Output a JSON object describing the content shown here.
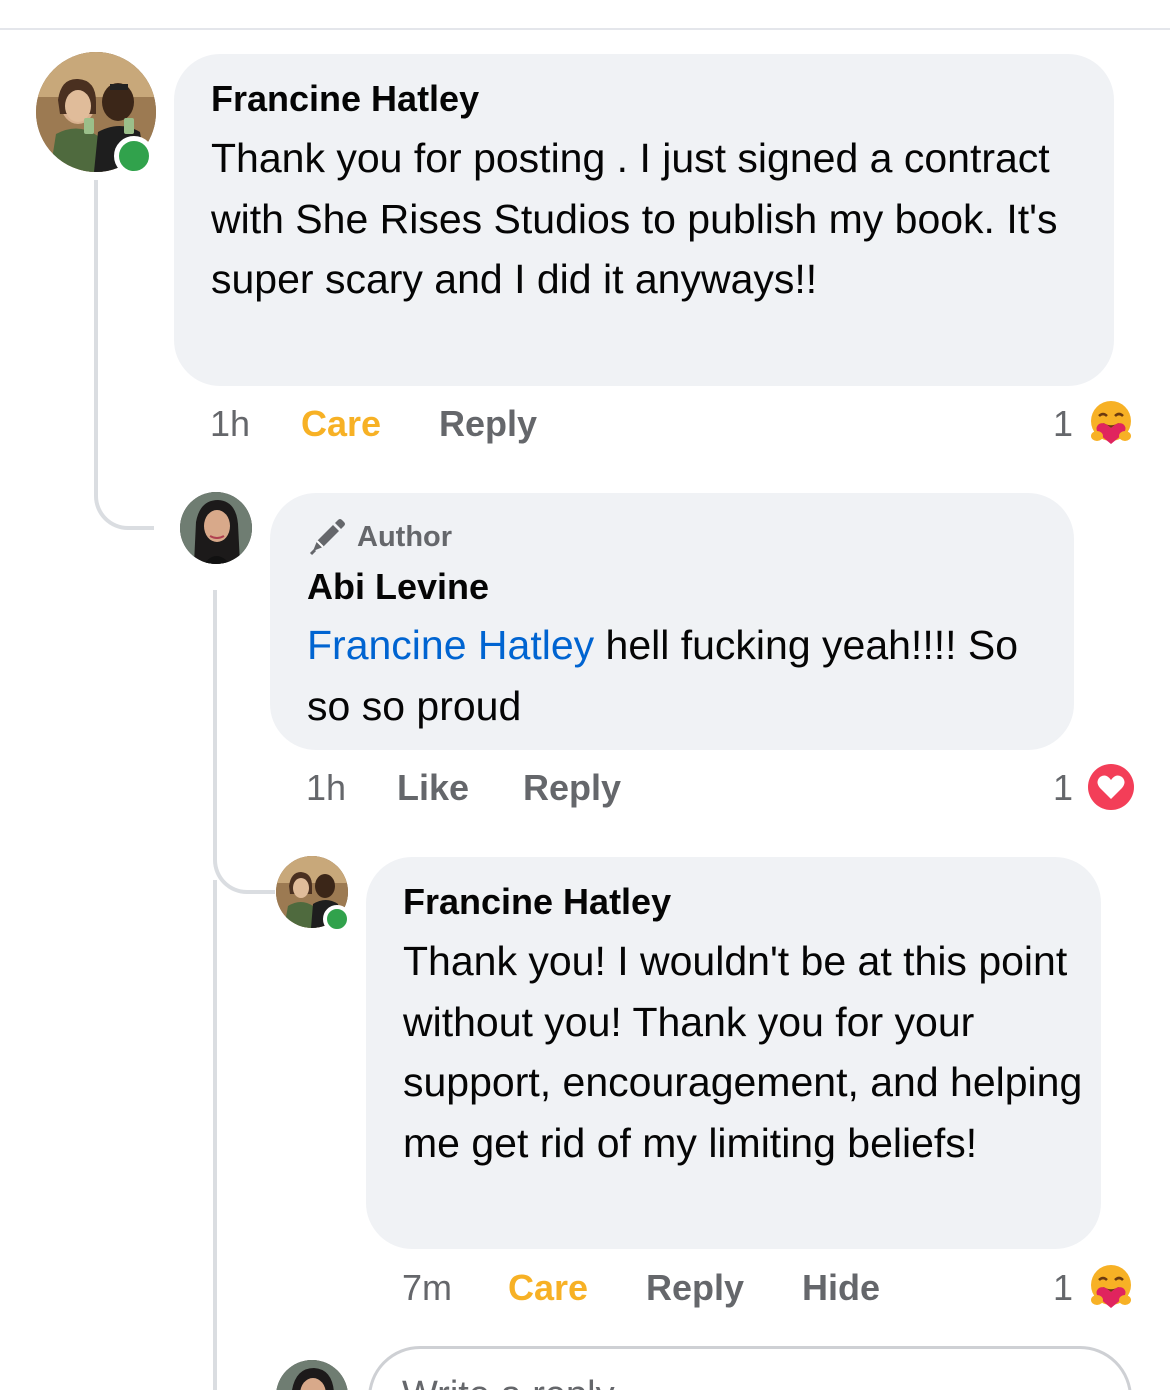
{
  "comments": [
    {
      "author": "Francine Hatley",
      "text": "Thank you for posting . I just signed a contract with She Rises Studios to publish my book. It's super scary and I did it anyways!!",
      "time": "1h",
      "reaction_action": "Care",
      "reply_label": "Reply",
      "reaction_count": "1",
      "reaction_icon": "care-emoji-icon"
    },
    {
      "badge": "Author",
      "badge_icon": "pen-icon",
      "author": "Abi Levine",
      "mention": "Francine Hatley",
      "text_after_mention": " hell fucking yeah!!!! So so so proud",
      "time": "1h",
      "like_label": "Like",
      "reply_label": "Reply",
      "reaction_count": "1",
      "reaction_icon": "love-heart-icon"
    },
    {
      "author": "Francine Hatley",
      "text": "Thank you! I wouldn't be at this point without you! Thank you for your support, encouragement, and helping me get rid of my limiting beliefs!",
      "time": "7m",
      "reaction_action": "Care",
      "reply_label": "Reply",
      "hide_label": "Hide",
      "reaction_count": "1",
      "reaction_icon": "care-emoji-icon"
    }
  ],
  "reply_box": {
    "placeholder": "Write a reply..."
  },
  "colors": {
    "bubble": "#f0f2f5",
    "care": "#f7b125",
    "secondary_text": "#65676b",
    "mention": "#0064d1",
    "online": "#31a24c",
    "love": "#f33e58"
  }
}
